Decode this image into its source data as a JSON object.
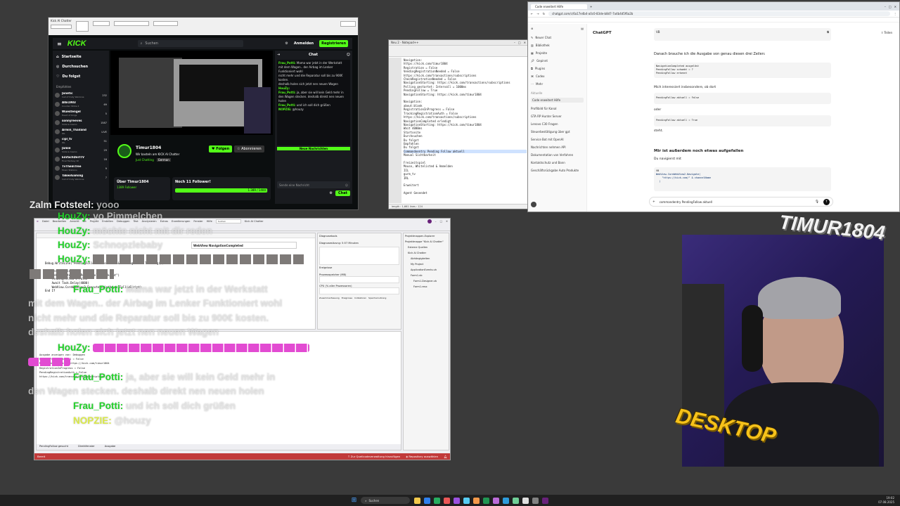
{
  "kick": {
    "title": "Kick AI Chatter",
    "logo": "KICK",
    "search_placeholder": "Suchen",
    "login": "Anmelden",
    "register": "Registrieren",
    "nav": [
      "Startseite",
      "Durchsuchen",
      "Du folgst"
    ],
    "recommended": "Empfohlen",
    "channels": [
      {
        "n": "Jonetic",
        "g": "Call of Duty Warzone",
        "v": "232"
      },
      {
        "n": "Albi1983",
        "g": "Counter Strike 2",
        "v": "69"
      },
      {
        "n": "Wuestengel",
        "g": "Heart of Kings",
        "v": "5"
      },
      {
        "n": "sonnyreeves",
        "g": "Slots & Casino",
        "v": "1587"
      },
      {
        "n": "Armin_Thailand",
        "g": "IRL",
        "v": "LIVE"
      },
      {
        "n": "cipl_tv",
        "g": "IRL",
        "v": "51"
      },
      {
        "n": "Jamie",
        "g": "Slots & Casino",
        "v": "29"
      },
      {
        "n": "EinfachDerITV",
        "g": "Final Fantasy VII",
        "v": "16"
      },
      {
        "n": "TvThemTree",
        "g": "Music Stations",
        "v": "9"
      },
      {
        "n": "TakeoGaming",
        "g": "Call of Duty Warzone",
        "v": "7"
      }
    ],
    "streamer": "Timur1804",
    "stream_title": "Wir basteln am KICK AI Chatter",
    "category": "Just Chatting",
    "lang": "German",
    "follow": "Folgen",
    "subscribe": "Abonnieren",
    "about": "Über Timur1804",
    "followers": "1389 Follower",
    "goal": "Noch 11 Follower!",
    "goal_progress": "1.389 / 1400",
    "chat_title": "Chat",
    "new_messages": "Neue Nachrichten",
    "send_placeholder": "Sende eine Nachricht",
    "chat_btn": "Chat"
  },
  "notepad": {
    "title": "Neu 2 - Notepad++",
    "lines": [
      "Navigation:",
      "https://kick.com/timur1804",
      "Registration = False",
      "VendingRegistrationNeeded = False",
      "https://kick.com/transactions/subscriptions",
      "CheckRegistrationNeeded = False",
      "NavigationStarting: https://kick.com/transactions/subscriptions",
      "Polling gestartet: Intervall = 1000ms",
      "PendingFollow = True",
      "NavigationStarting: https://kick.com/timur1804",
      "",
      "Navigation:",
      "about:blank",
      "RegistrationInProgress = False",
      "TrackingRegistrationAuth = False",
      "https://kick.com/transactions/subscriptions",
      "NavigationCompleted erledigt",
      "NavigationStarting: https://kick.com/timur1804",
      "Wait 4000ms",
      "Startseite",
      "Durchsuchen",
      "Du folgst",
      "Empfohlen",
      "Du folgst",
      "Commandoentry Pending Follow aktuell",
      "Manual Sichtbarkeit",
      "",
      "Freizeitspiel",
      "Mouse, Whitelisted & Anmelden",
      "IIL",
      "gurm_tv",
      "IRL",
      "",
      "Erweitert",
      "",
      "Agent Gesendet"
    ],
    "status": "length : 1,661   lines : 124"
  },
  "browser": {
    "tab": "Code erweitert Hilfe",
    "url": "chatgpt.com/c/6a17e4b4-a0c0-83de-b8d7-7a4b4d5f6a2b",
    "model": "ChatGPT",
    "share": "Teilen",
    "sidebar": [
      "Neuer Chat",
      "Bibliothek",
      "Projekte",
      "Gepinnt",
      "Plugins",
      "Codex",
      "Mehr"
    ],
    "recent_label": "Aktuelle",
    "recent": [
      "Code erweitert Hilfe",
      "Profilbild für Kanal",
      "GTA RP Hunter Server",
      "Lenovo C30 Fragen",
      "Steuerbestätigung über gpt",
      "Service Bot mit OpenAI",
      "Nachrichten nehmen API",
      "Dokumentation von Verfahren",
      "Kontaktschutz und Bann",
      "Geschäftsrückgabe Auto Produkte"
    ],
    "code_lang": "VB",
    "msg1": "Danach brauche ich die Ausgabe von genau diesen drei Zeilen:",
    "code1": [
      "NavigationCompleted ausgelöst",
      "PendingFollow schwebt = ?",
      "PendingFollow erkennt"
    ],
    "msg2": "Mich interessiert insbesondere, ob dort",
    "code2": "PendingFollow aktuell = False",
    "msg3": "oder",
    "code3": "PendingFollow aktuell = True",
    "msg4": "steht.",
    "msg5": "Mir ist außerdem noch etwas aufgefallen",
    "msg6": "Du navigierst mit",
    "code4": [
      "WebView.CoreWebView2.Navigate(",
      "    \"https://kick.com/\" & channelName",
      "  )"
    ],
    "input_value": "commandentry PendingFollow aktuell"
  },
  "vs": {
    "title": "Kick AI Chatter",
    "menu": [
      "Datei",
      "Bearbeiten",
      "Ansicht",
      "Git",
      "Projekt",
      "Erstellen",
      "Debuggen",
      "Test",
      "Analysieren",
      "Extras",
      "Erweiterungen",
      "Fenster",
      "Hilfe"
    ],
    "search": "Suchen",
    "code_lines": [
      "Debug.WriteLine(\"PendingFollow aktuell = \" & PendingFollow.ToString())",
      "",
      "If PendingFollow Then",
      "    Debug.WriteLine(\"PendingFollow erkannt\")",
      "    PendingFollow = False",
      "    Await Task.Delay(4000)",
      "    WebView.CoreWebView2.ExecuteScriptAsync(FollowScript)",
      "End If"
    ],
    "webview_title": "WebView NavigationCompleted",
    "diag_title": "Diagnosetools",
    "diag_session": "Diagnosesitzung: 5:57 Minuten",
    "events": "Ereignisse",
    "mem_label": "Prozessspeicher (MB)",
    "cpu_label": "CPU (% aller Prozessoren)",
    "summary_tabs": [
      "Zusammenfassung",
      "Ereignisse",
      "Indikatoren",
      "Speichernutzung"
    ],
    "solution_title": "Projektmappen-Explorer",
    "solution": [
      "Projektmappe \"Kick AI Chatter\"",
      "Externe Quellen",
      "Kick AI Chatter",
      "Abhängigkeiten",
      "My Project",
      "ApplicationEvents.vb",
      "Form1.vb",
      "Form1.Designer.vb",
      "Form1.resx"
    ],
    "output_lines": [
      "Ausgabe anzeigen von: Debuggen",
      "PendingFollow aktuell = False",
      "NavigationStarting: https://kick.com/timur1804",
      "RegistrationInProgress = False",
      "PendingRegistrationAuth = False",
      "https://kick.com/transactions/subscriptions"
    ],
    "bottom_tabs": [
      "PendingFollow gesucht",
      "Direktfenster",
      "Ausgabe"
    ],
    "status_ready": "Bereit",
    "status_git": "Zur Quellcodeverwaltung hinzufügen",
    "status_repo": "Repository auswählen"
  },
  "chat_overlay": [
    {
      "user": "Zalm Fotsteel",
      "text": "yooo"
    },
    {
      "user": "HouZy",
      "text": "yo Pimmelchen"
    },
    {
      "user": "HouZy",
      "text": "möchte nicht mit dir reden"
    },
    {
      "user": "HouZy",
      "text": "Schnopzlebaby"
    },
    {
      "user": "HouZy",
      "text": ""
    },
    {
      "user": "Frau_Potti",
      "text": "Mama war jetzt in der Werkstatt"
    },
    {
      "user": "",
      "text": "mit dem Wagen.. der Airbag im Lenker Funktioniert wohl"
    },
    {
      "user": "",
      "text": "nicht mehr und die Reparatur soll bis zu 900€ kosten."
    },
    {
      "user": "",
      "text": "deshalb holen sich jetzt nen neuen Wagen"
    },
    {
      "user": "HouZy",
      "text": ""
    },
    {
      "user": "Frau_Potti",
      "text": "ja, aber sie will kein Geld mehr in"
    },
    {
      "user": "",
      "text": "den Wagen stecken. deshalb direkt nen neuen holen"
    },
    {
      "user": "Frau_Potti",
      "text": "und ich soll dich grüßen"
    },
    {
      "user": "NOPZIE",
      "text": "@houzy"
    }
  ],
  "webcam_logo": "TIMUR1804",
  "desktop_logo": "DESKTOP",
  "taskbar": {
    "search": "Suchen",
    "time": "19:02",
    "date": "07.08.2025"
  },
  "colors": {
    "kick_green": "#53fc18",
    "chat_green": "#22d12a",
    "vs_purple": "#68217a"
  }
}
